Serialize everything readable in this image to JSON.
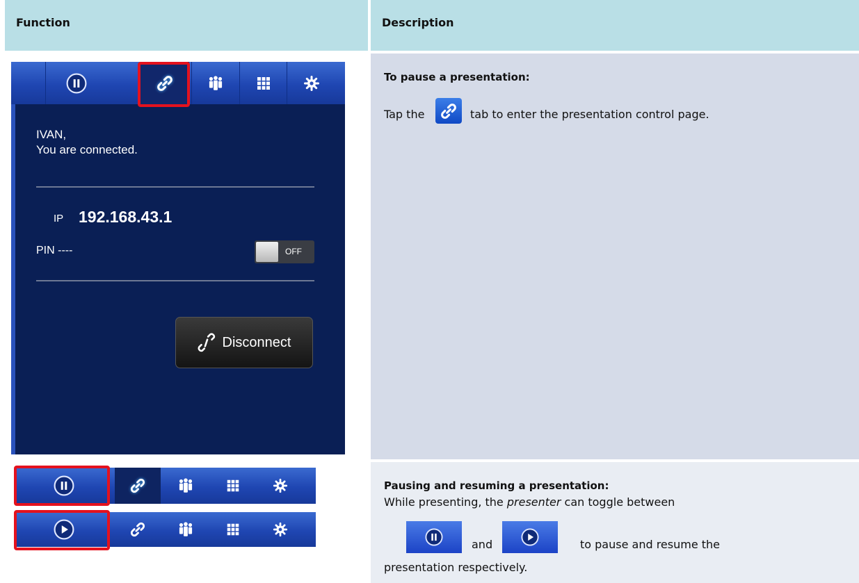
{
  "table": {
    "header": {
      "function": "Function",
      "description": "Description"
    },
    "row1": {
      "title": "To pause a presentation:",
      "text_before": "Tap the",
      "text_after": "tab to enter the presentation control page."
    },
    "row2": {
      "title": "Pausing and resuming a presentation:",
      "line1_before": "While presenting, the ",
      "line1_em": "presenter",
      "line1_after": " can toggle between",
      "and": "and",
      "line2_after": "to pause and resume the",
      "line3": "presentation respectively."
    }
  },
  "phone": {
    "greeting_name": "IVAN,",
    "greeting_status": "You are connected.",
    "ip_label": "IP",
    "ip_value": "192.168.43.1",
    "pin_label": "PIN ----",
    "toggle_label": "OFF",
    "disconnect_label": "Disconnect"
  },
  "icons": {
    "tabs": [
      "pause-icon",
      "link-icon",
      "people-icon",
      "grid-icon",
      "gear-icon"
    ],
    "play": "play-icon"
  },
  "colors": {
    "header_bg": "#b9dfe6",
    "row_bg": "#d5dbe8",
    "highlight": "#e4121e",
    "tab_blue": "#1f46b2",
    "screen_bg": "#0a1f55"
  }
}
